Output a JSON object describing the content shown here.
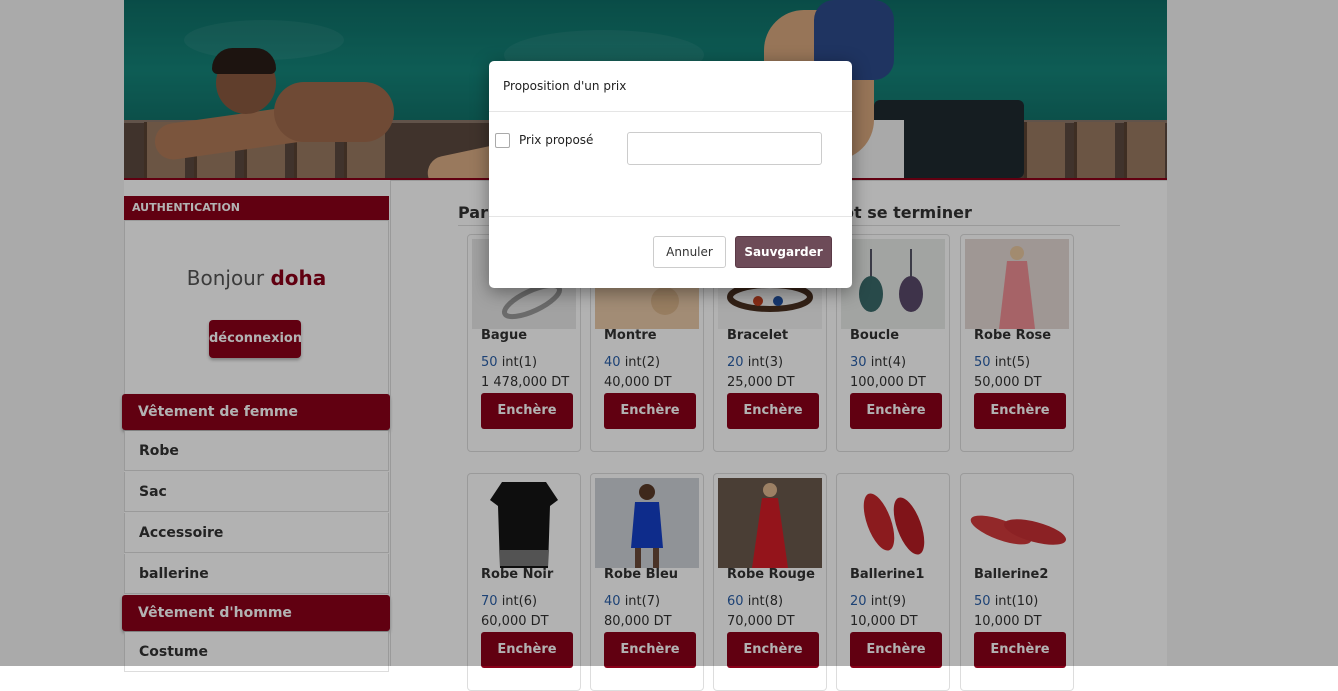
{
  "colors": {
    "brand": "#8b0019",
    "link_number": "#2a5fa8",
    "save_button": "#6d4b58"
  },
  "sidebar": {
    "auth_header": "AUTHENTICATION",
    "greeting": "Bonjour",
    "username": "doha",
    "logout_label": "déconnexion",
    "women_header": "Vêtement de femme",
    "women_items": [
      "Robe",
      "Sac",
      "Accessoire",
      "ballerine"
    ],
    "men_header": "Vêtement d'homme",
    "men_items": [
      "Costume"
    ]
  },
  "main": {
    "section_title_left": "Par",
    "section_title_right": "ôt se terminer",
    "bid_label": "Enchère",
    "products": [
      {
        "name": "Bague",
        "count": "50",
        "bids": "int(1)",
        "price": "1 478,000 DT",
        "image": "ring"
      },
      {
        "name": "Montre",
        "count": "40",
        "bids": "int(2)",
        "price": "40,000 DT",
        "image": "watch"
      },
      {
        "name": "Bracelet",
        "count": "20",
        "bids": "int(3)",
        "price": "25,000 DT",
        "image": "bracelet"
      },
      {
        "name": "Boucle",
        "count": "30",
        "bids": "int(4)",
        "price": "100,000 DT",
        "image": "earrings"
      },
      {
        "name": "Robe Rose",
        "count": "50",
        "bids": "int(5)",
        "price": "50,000 DT",
        "image": "pink-dress"
      },
      {
        "name": "Robe Noir",
        "count": "70",
        "bids": "int(6)",
        "price": "60,000 DT",
        "image": "black-dress"
      },
      {
        "name": "Robe Bleu",
        "count": "40",
        "bids": "int(7)",
        "price": "80,000 DT",
        "image": "blue-dress"
      },
      {
        "name": "Robe Rouge",
        "count": "60",
        "bids": "int(8)",
        "price": "70,000 DT",
        "image": "red-dress"
      },
      {
        "name": "Ballerine1",
        "count": "20",
        "bids": "int(9)",
        "price": "10,000 DT",
        "image": "red-flats"
      },
      {
        "name": "Ballerine2",
        "count": "50",
        "bids": "int(10)",
        "price": "10,000 DT",
        "image": "red-flats-2"
      }
    ]
  },
  "modal": {
    "title": "Proposition d'un prix",
    "checkbox_label": "Prix proposé",
    "input_value": "",
    "cancel_label": "Annuler",
    "save_label": "Sauvgarder"
  }
}
